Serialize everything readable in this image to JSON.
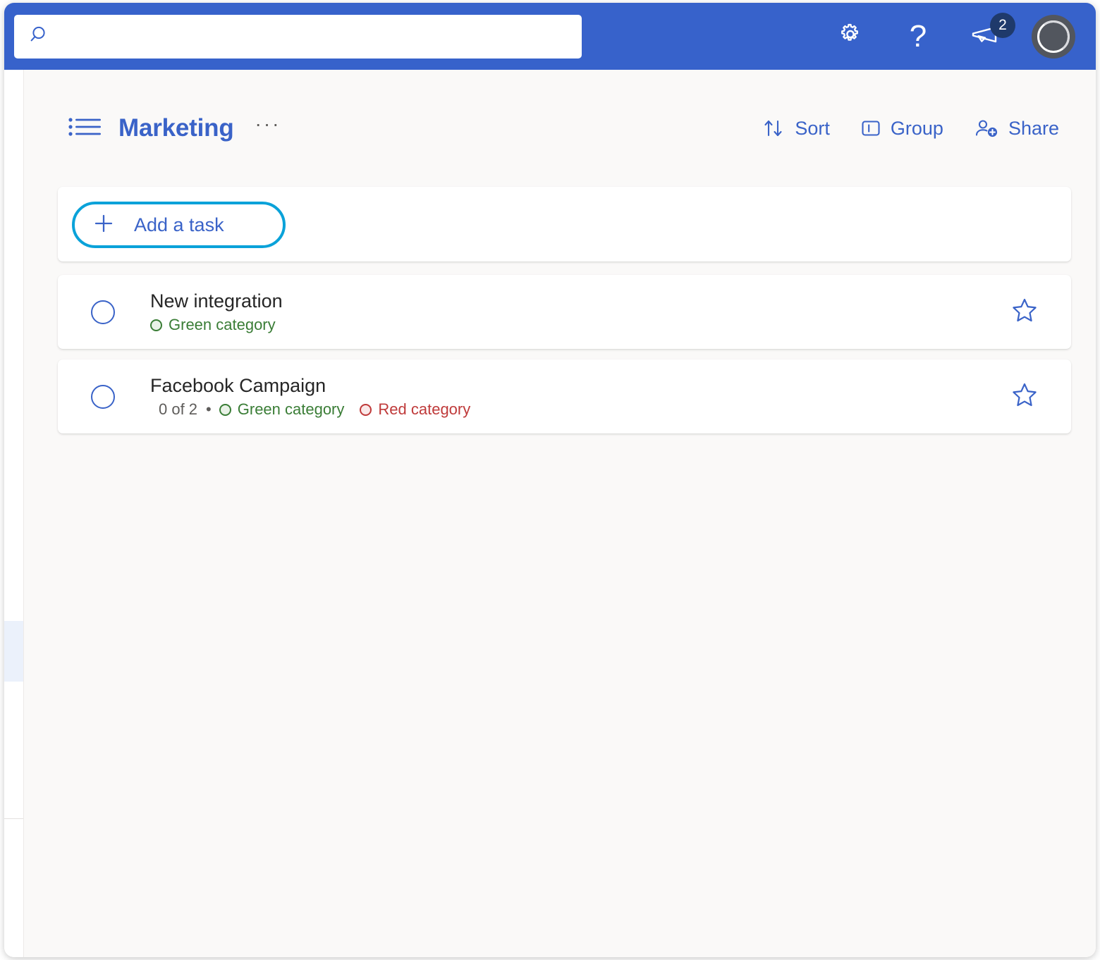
{
  "colors": {
    "header_blue": "#3762cb",
    "accent_blue": "#3a63c8",
    "focus_cyan": "#0aa2d9",
    "green": "#3a7d36",
    "red": "#bf3a3a",
    "page_bg": "#faf9f8",
    "badge_navy": "#1f3a6b"
  },
  "topbar": {
    "search": {
      "icon": "search-icon",
      "value": "",
      "placeholder": ""
    },
    "actions": [
      {
        "name": "settings",
        "icon": "gear-icon",
        "label": "Settings"
      },
      {
        "name": "help",
        "icon": "question-mark-icon",
        "label": "?"
      },
      {
        "name": "announcements",
        "icon": "megaphone-icon",
        "label": "Announcements",
        "badge": "2"
      },
      {
        "name": "account",
        "icon": "avatar-icon",
        "label": "Account"
      }
    ]
  },
  "sidebar": {
    "selected_strip": true
  },
  "list_header": {
    "icon": "bulleted-list-icon",
    "title": "Marketing",
    "overflow_label": "···",
    "actions": [
      {
        "name": "sort",
        "icon": "sort-arrows-icon",
        "label": "Sort"
      },
      {
        "name": "group",
        "icon": "group-panel-icon",
        "label": "Group"
      },
      {
        "name": "share",
        "icon": "person-add-icon",
        "label": "Share"
      }
    ]
  },
  "add_task": {
    "icon": "plus-icon",
    "label": "Add a task"
  },
  "tasks": [
    {
      "title": "New integration",
      "progress": "",
      "separator": "",
      "categories": [
        {
          "label": "Green category",
          "color": "green"
        }
      ],
      "starred": false,
      "completed": false
    },
    {
      "title": "Facebook Campaign",
      "progress": "0 of 2",
      "separator": "•",
      "categories": [
        {
          "label": "Green category",
          "color": "green"
        },
        {
          "label": "Red category",
          "color": "red"
        }
      ],
      "starred": false,
      "completed": false
    }
  ]
}
